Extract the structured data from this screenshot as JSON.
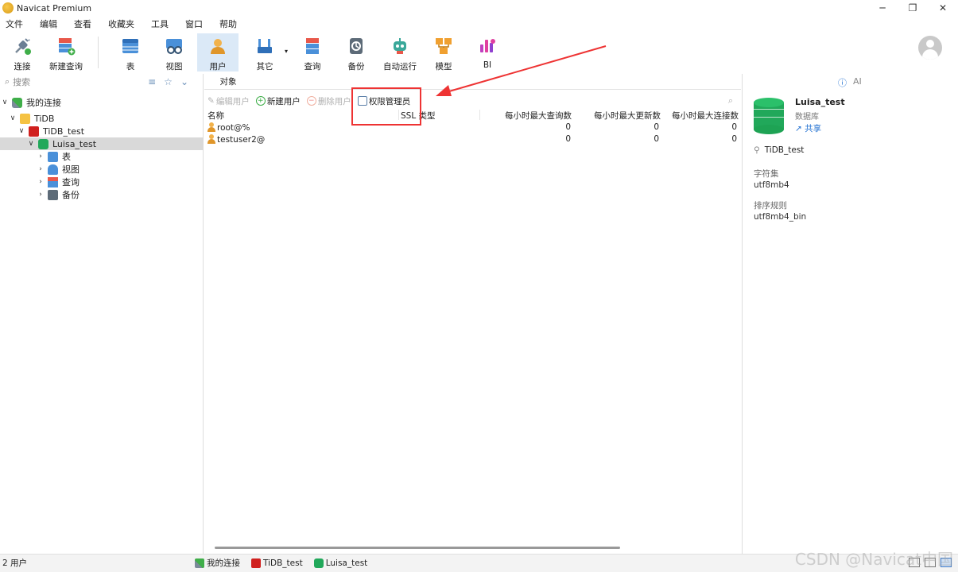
{
  "window": {
    "title": "Navicat Premium",
    "controls": [
      "─",
      "❐",
      "✕"
    ]
  },
  "menu": [
    "文件",
    "编辑",
    "查看",
    "收藏夹",
    "工具",
    "窗口",
    "帮助"
  ],
  "toolbar": {
    "connect": "连接",
    "new_query": "新建查询",
    "table": "表",
    "view": "视图",
    "user": "用户",
    "other": "其它",
    "query": "查询",
    "backup": "备份",
    "automation": "自动运行",
    "model": "模型",
    "bi": "BI"
  },
  "sidebar": {
    "search_placeholder": "搜索",
    "tree": {
      "root": "我的连接",
      "group": "TiDB",
      "connection": "TiDB_test",
      "database": "Luisa_test",
      "children": [
        "表",
        "视图",
        "查询",
        "备份"
      ]
    }
  },
  "main": {
    "tab": "对象",
    "actions": {
      "edit_user": "编辑用户",
      "new_user": "新建用户",
      "delete_user": "删除用户",
      "privilege_manager": "权限管理员"
    },
    "columns": [
      "名称",
      "SSL 类型",
      "每小时最大查询数",
      "每小时最大更新数",
      "每小时最大连接数"
    ],
    "rows": [
      {
        "name": "root@%",
        "ssl": "",
        "max_queries": "0",
        "max_updates": "0",
        "max_connections": "0"
      },
      {
        "name": "testuser2@",
        "ssl": "",
        "max_queries": "0",
        "max_updates": "0",
        "max_connections": "0"
      }
    ]
  },
  "info_panel": {
    "ai_label": "AI",
    "name": "Luisa_test",
    "type": "数据库",
    "share": "共享",
    "connection": "TiDB_test",
    "charset_label": "字符集",
    "charset_value": "utf8mb4",
    "collation_label": "排序规则",
    "collation_value": "utf8mb4_bin"
  },
  "statusbar": {
    "count": "2 用户",
    "crumbs": [
      "我的连接",
      "TiDB_test",
      "Luisa_test"
    ]
  },
  "watermark": "CSDN @Navicat中国",
  "colors": {
    "accent": "#1f6fd1",
    "selection": "#dbe9f7",
    "db_green": "#21a85a",
    "annotation": "#e33333"
  }
}
